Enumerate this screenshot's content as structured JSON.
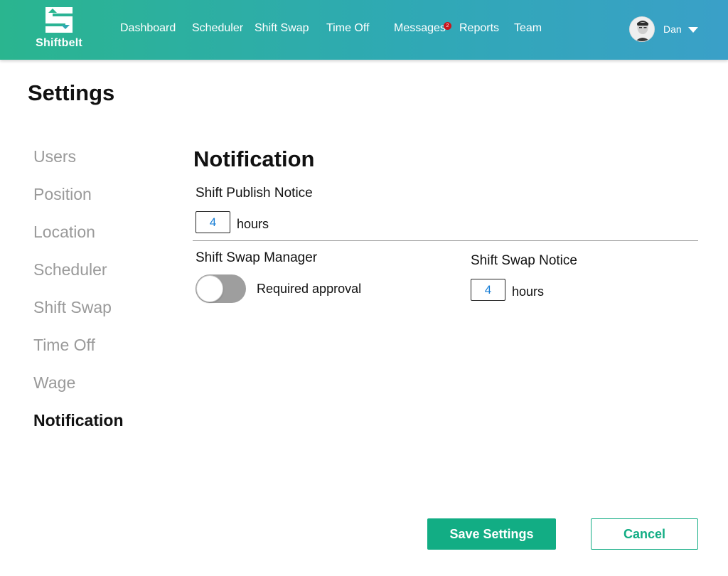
{
  "brand": {
    "name": "Shiftbelt",
    "logo_icon": "shiftbelt-s-arrows-icon"
  },
  "nav": {
    "items": [
      {
        "label": "Dashboard"
      },
      {
        "label": "Scheduler"
      },
      {
        "label": "Shift Swap"
      },
      {
        "label": "Time Off"
      },
      {
        "label": "Messages",
        "badge": "2"
      },
      {
        "label": "Reports"
      },
      {
        "label": "Team"
      }
    ]
  },
  "user": {
    "name": "Dan",
    "avatar_icon": "user-avatar-icon",
    "menu_icon": "caret-down-icon"
  },
  "page": {
    "title": "Settings"
  },
  "sidebar": {
    "items": [
      {
        "label": "Users",
        "active": false
      },
      {
        "label": "Position",
        "active": false
      },
      {
        "label": "Location",
        "active": false
      },
      {
        "label": "Scheduler",
        "active": false
      },
      {
        "label": "Shift Swap",
        "active": false
      },
      {
        "label": "Time Off",
        "active": false
      },
      {
        "label": "Wage",
        "active": false
      },
      {
        "label": "Notification",
        "active": true
      }
    ]
  },
  "notification": {
    "title": "Notification",
    "shift_publish_notice": {
      "label": "Shift Publish Notice",
      "value": "4",
      "unit": "hours"
    },
    "shift_swap_manager": {
      "label": "Shift Swap Manager",
      "toggle_label": "Required approval",
      "enabled": false
    },
    "shift_swap_notice": {
      "label": "Shift Swap Notice",
      "value": "4",
      "unit": "hours"
    }
  },
  "actions": {
    "save_label": "Save Settings",
    "cancel_label": "Cancel"
  },
  "colors": {
    "primary": "#12ad84",
    "header_gradient_start": "#2ab58f",
    "header_gradient_end": "#3aa0c8",
    "badge": "#c9161d",
    "input_text": "#1a7fd6",
    "toggle_off": "#9e9e9e",
    "sidebar_inactive": "#9a9a9a"
  }
}
